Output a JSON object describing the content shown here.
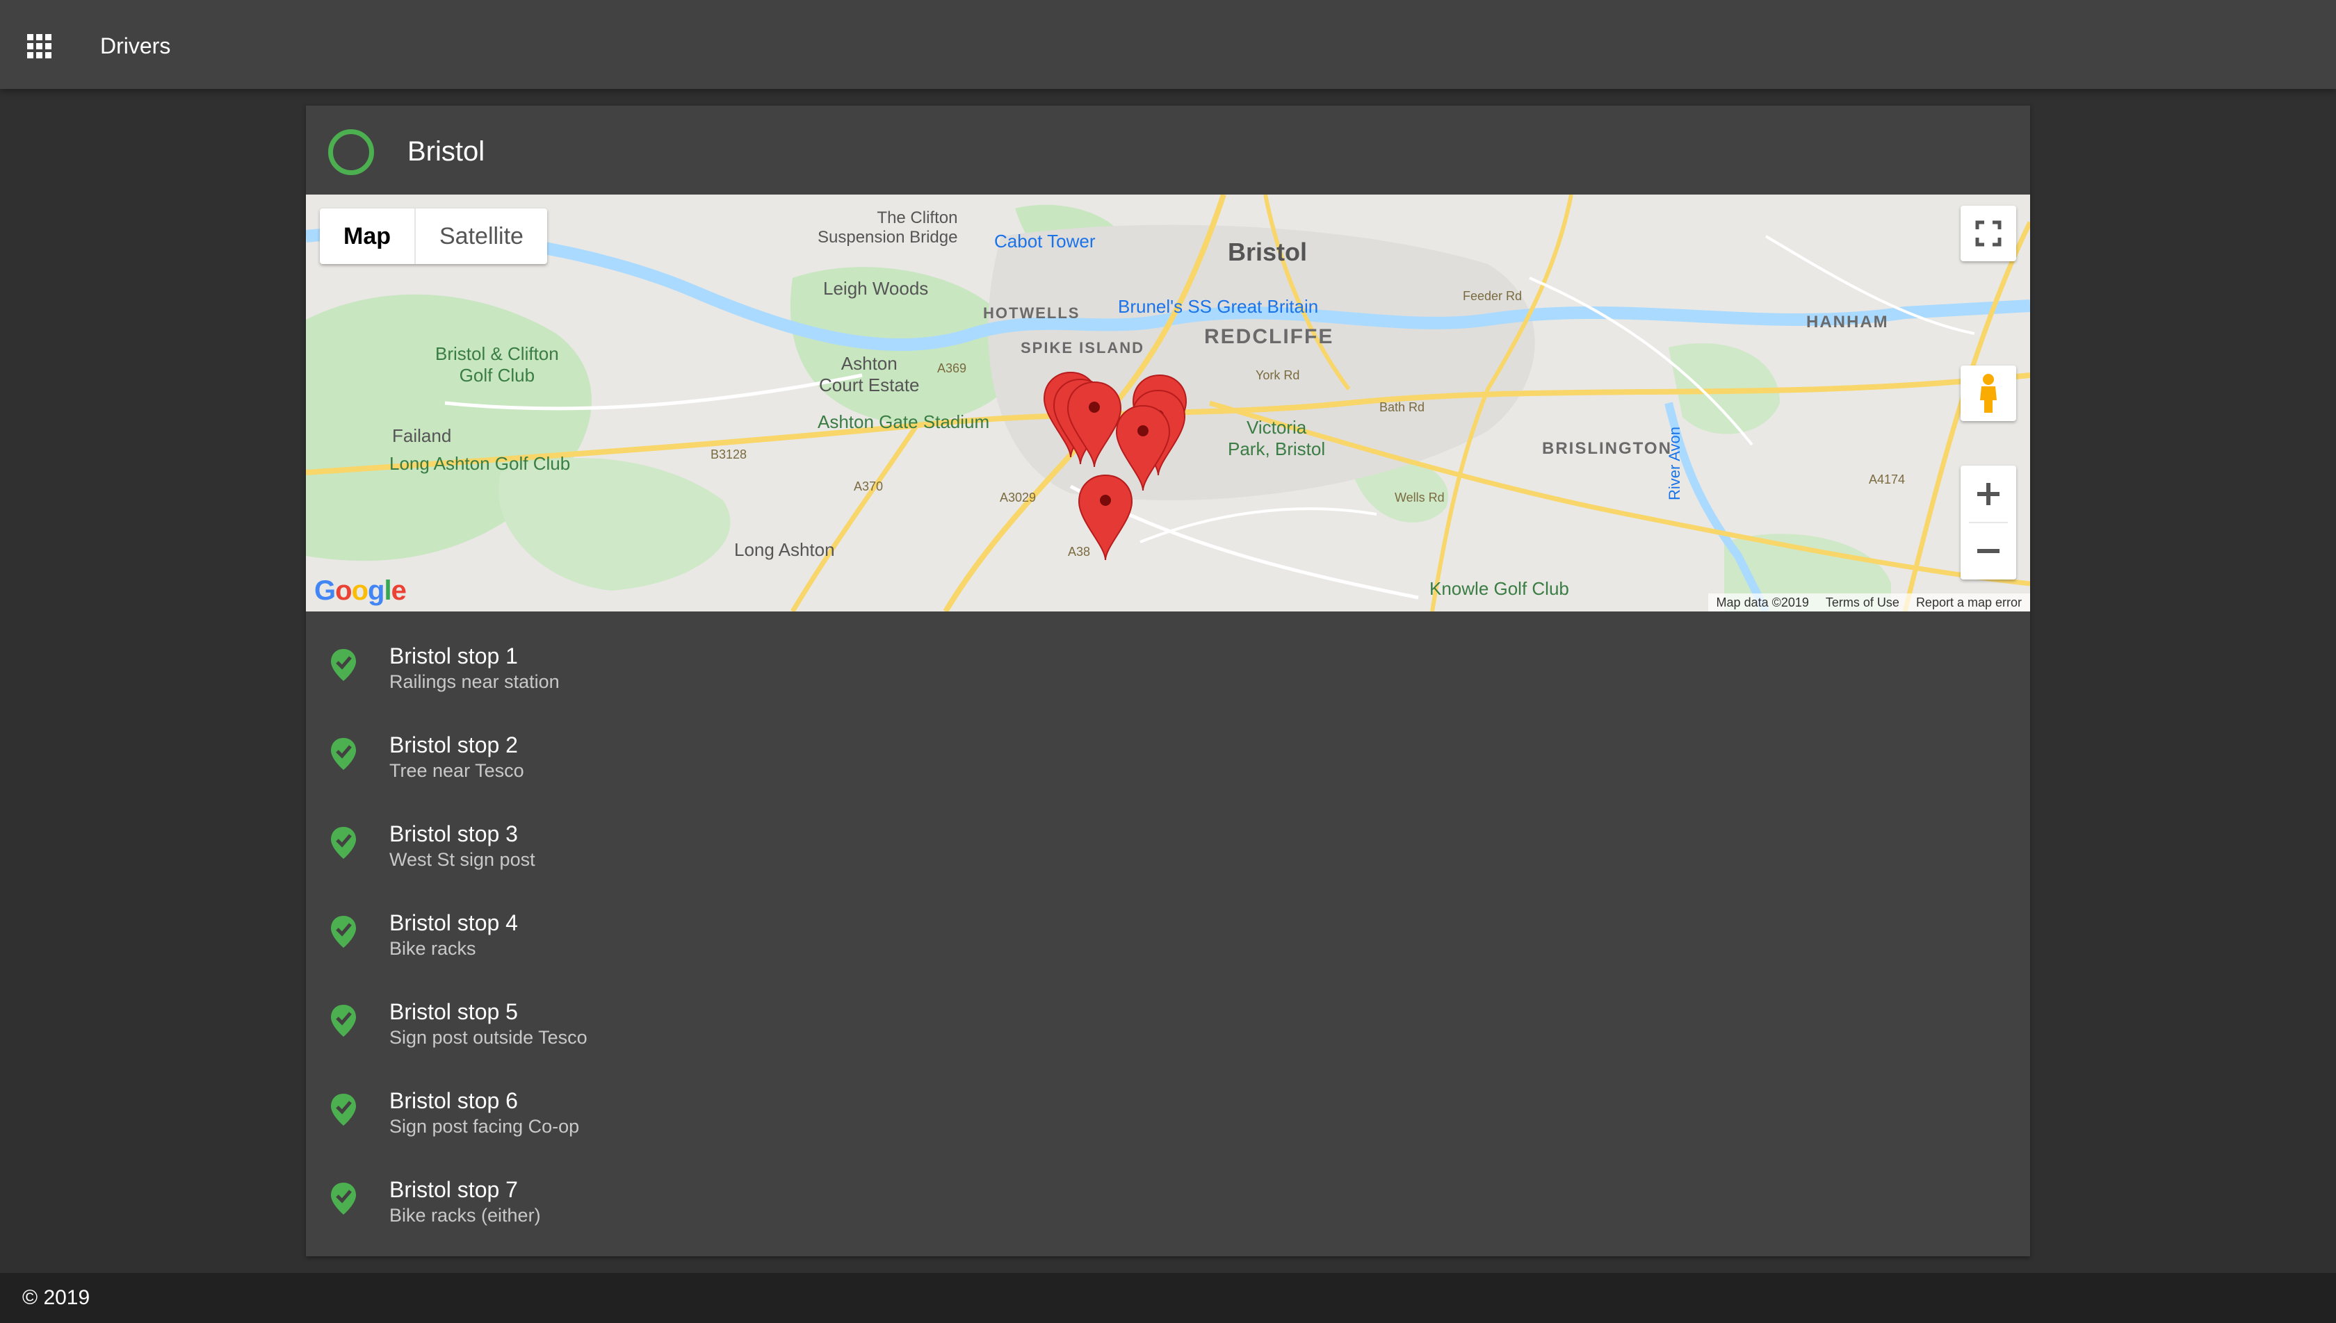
{
  "app": {
    "title": "Drivers",
    "apps_icon": "apps-grid-icon"
  },
  "route": {
    "name": "Bristol",
    "status_color": "#4caf50"
  },
  "map": {
    "type_options": [
      "Map",
      "Satellite"
    ],
    "selected_type": "Map",
    "labels": {
      "bristol": "Bristol",
      "clifton_bridge": "The Clifton\nSuspension Bridge",
      "cabot_tower": "Cabot Tower",
      "leigh_woods": "Leigh Woods",
      "hotwells": "HOTWELLS",
      "ss_great_britain": "Brunel's SS Great Britain",
      "spike_island": "SPIKE ISLAND",
      "redcliffe": "REDCLIFFE",
      "clifton_golf": "Bristol & Clifton\nGolf Club",
      "ashton_court": "Ashton\nCourt Estate",
      "ashton_gate": "Ashton Gate Stadium",
      "failand": "Failand",
      "long_ashton_golf": "Long Ashton Golf Club",
      "long_ashton": "Long Ashton",
      "victoria_park": "Victoria\nPark, Bristol",
      "hanham": "HANHAM",
      "brislington": "BRISLINGTON",
      "knowle_golf": "Knowle Golf Club",
      "river_avon": "River Avon",
      "york_rd": "York Rd",
      "bath_rd": "Bath Rd",
      "wells_rd": "Wells Rd",
      "a370": "A370",
      "a369": "A369",
      "a3029": "A3029",
      "a38": "A38",
      "a4174": "A4174",
      "b3128": "B3128",
      "feeder_rd": "Feeder Rd"
    },
    "footer": {
      "data": "Map data ©2019",
      "terms": "Terms of Use",
      "report": "Report a map error"
    },
    "logo": "Google",
    "controls": {
      "fullscreen_icon": "fullscreen-icon",
      "pegman_icon": "pegman-icon",
      "zoom_in_icon": "plus-icon",
      "zoom_out_icon": "minus-icon"
    },
    "pin_color": "#e53935"
  },
  "stops": [
    {
      "name": "Bristol stop 1",
      "description": "Railings near station"
    },
    {
      "name": "Bristol stop 2",
      "description": "Tree near Tesco"
    },
    {
      "name": "Bristol stop 3",
      "description": "West St sign post"
    },
    {
      "name": "Bristol stop 4",
      "description": "Bike racks"
    },
    {
      "name": "Bristol stop 5",
      "description": "Sign post outside Tesco"
    },
    {
      "name": "Bristol stop 6",
      "description": "Sign post facing Co-op"
    },
    {
      "name": "Bristol stop 7",
      "description": "Bike racks (either)"
    }
  ],
  "stop_icon": "check-pin-icon",
  "footer": {
    "copyright": "© 2019"
  }
}
